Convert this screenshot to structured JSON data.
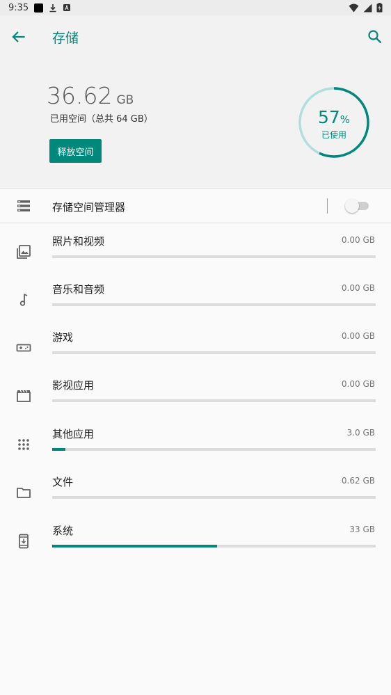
{
  "status_bar": {
    "time": "9:35"
  },
  "app_bar": {
    "title": "存储"
  },
  "summary": {
    "used_number": "36.62",
    "used_unit": "GB",
    "total_text": "已用空间（总共 64 GB）",
    "free_button": "释放空间",
    "percent": "57",
    "percent_symbol": "%",
    "percent_value": 0.57,
    "percent_label": "已使用"
  },
  "manager": {
    "label": "存储空间管理器",
    "enabled": false
  },
  "categories": [
    {
      "label": "照片和视频",
      "size": "0.00 GB",
      "fill": 0.0,
      "icon": "photo-icon"
    },
    {
      "label": "音乐和音频",
      "size": "0.00 GB",
      "fill": 0.0,
      "icon": "music-note-icon"
    },
    {
      "label": "游戏",
      "size": "0.00 GB",
      "fill": 0.0,
      "icon": "gamepad-icon"
    },
    {
      "label": "影视应用",
      "size": "0.00 GB",
      "fill": 0.0,
      "icon": "movie-icon"
    },
    {
      "label": "其他应用",
      "size": "3.0 GB",
      "fill": 0.04,
      "icon": "apps-grid-icon"
    },
    {
      "label": "文件",
      "size": "0.62 GB",
      "fill": 0.0,
      "icon": "folder-icon"
    },
    {
      "label": "系统",
      "size": "33 GB",
      "fill": 0.51,
      "icon": "system-update-icon"
    }
  ],
  "colors": {
    "accent": "#00897b",
    "track": "#dcdcdc",
    "donut_track": "#b2dfdb"
  }
}
